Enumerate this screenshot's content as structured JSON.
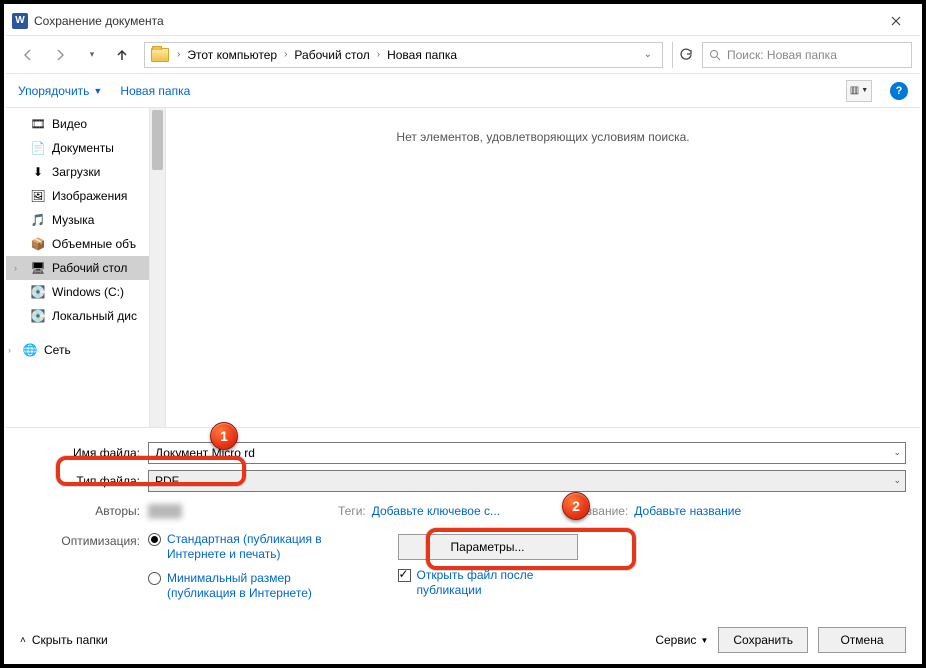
{
  "titlebar": {
    "app_icon_letter": "W",
    "title": "Сохранение документа"
  },
  "nav": {
    "breadcrumb": [
      "Этот компьютер",
      "Рабочий стол",
      "Новая папка"
    ],
    "search_placeholder": "Поиск: Новая папка"
  },
  "toolbar": {
    "organize": "Упорядочить",
    "new_folder": "Новая папка"
  },
  "tree": {
    "items": [
      {
        "label": "Видео",
        "icon": "🎞"
      },
      {
        "label": "Документы",
        "icon": "📄"
      },
      {
        "label": "Загрузки",
        "icon": "⬇"
      },
      {
        "label": "Изображения",
        "icon": "🖼"
      },
      {
        "label": "Музыка",
        "icon": "🎵"
      },
      {
        "label": "Объемные объ",
        "icon": "📦"
      },
      {
        "label": "Рабочий стол",
        "icon": "🖥",
        "selected": true
      },
      {
        "label": "Windows (C:)",
        "icon": "💽"
      },
      {
        "label": "Локальный дис",
        "icon": "💽"
      },
      {
        "label": "Сеть",
        "icon": "🌐",
        "expandable": true,
        "top": true
      }
    ]
  },
  "content": {
    "empty_message": "Нет элементов, удовлетворяющих условиям поиска."
  },
  "form": {
    "filename_label": "Имя файла:",
    "filename_value": "Документ Micro            rd",
    "filetype_label": "Тип файла:",
    "filetype_value": "PDF",
    "authors_label": "Авторы:",
    "tags_label": "Теги:",
    "tags_value": "Добавьте ключевое с...",
    "title_label": "азвание:",
    "title_value": "Добавьте название",
    "optimize_label": "Оптимизация:",
    "opt_standard": "Стандартная (публикация в Интернете и печать)",
    "opt_min": "Минимальный размер (публикация в Интернете)",
    "params_button": "Параметры...",
    "open_after": "Открыть файл после публикации"
  },
  "footer": {
    "hide_folders": "Скрыть папки",
    "tools": "Сервис",
    "save": "Сохранить",
    "cancel": "Отмена"
  },
  "annotations": {
    "num1": "1",
    "num2": "2"
  }
}
